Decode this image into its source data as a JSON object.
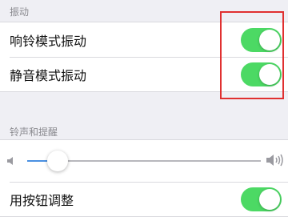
{
  "vibrate": {
    "header": "振动",
    "items": [
      {
        "label": "响铃模式振动",
        "on": true
      },
      {
        "label": "静音模式振动",
        "on": true
      }
    ]
  },
  "ringer": {
    "header": "铃声和提醒",
    "volume_level": 0.13,
    "adjust_label": "用按钮调整",
    "adjust_on": true
  },
  "colors": {
    "toggle_on": "#4cd964",
    "highlight_border": "#e03030",
    "slider_fill": "#4a90e2"
  }
}
